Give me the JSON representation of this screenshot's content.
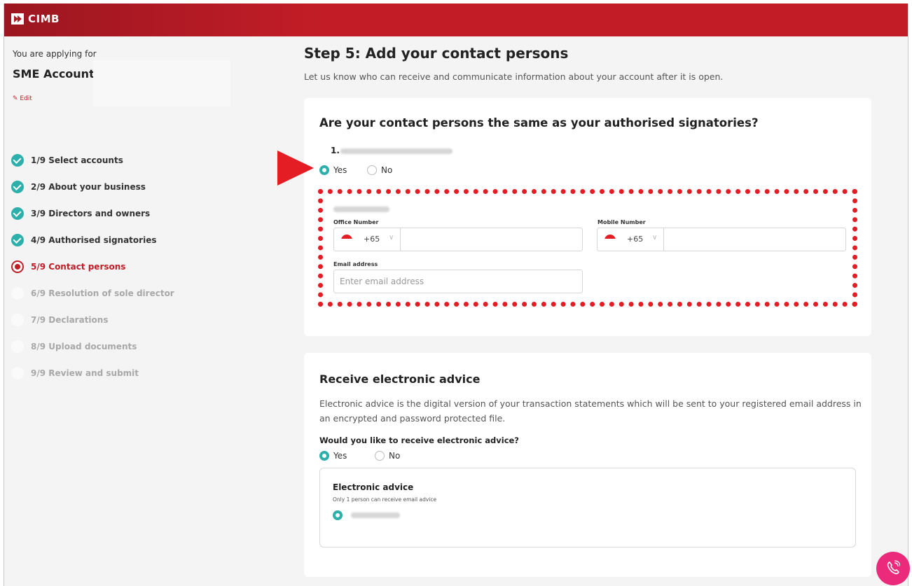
{
  "header": {
    "brand": "CIMB"
  },
  "sidebar": {
    "applying_label": "You are applying for",
    "account_name": "SME Account",
    "edit_label": "Edit",
    "steps": [
      {
        "label": "1/9 Select accounts",
        "status": "done"
      },
      {
        "label": "2/9 About your business",
        "status": "done"
      },
      {
        "label": "3/9 Directors and owners",
        "status": "done"
      },
      {
        "label": "4/9 Authorised signatories",
        "status": "done"
      },
      {
        "label": "5/9 Contact persons",
        "status": "current"
      },
      {
        "label": "6/9 Resolution of sole director",
        "status": "todo"
      },
      {
        "label": "7/9 Declarations",
        "status": "todo"
      },
      {
        "label": "8/9 Upload documents",
        "status": "todo"
      },
      {
        "label": "9/9 Review and submit",
        "status": "todo"
      }
    ]
  },
  "main": {
    "title": "Step 5: Add your contact persons",
    "subtitle": "Let us know who can receive and communicate information about your account after it is open.",
    "contact_card": {
      "question": "Are your contact persons the same as your authorised signatories?",
      "person_number": "1.",
      "yes_label": "Yes",
      "no_label": "No",
      "selected": "yes",
      "office_label": "Office Number",
      "mobile_label": "Mobile Number",
      "office_code": "+65",
      "mobile_code": "+65",
      "email_label": "Email address",
      "email_placeholder": "Enter email address"
    },
    "advice_card": {
      "title": "Receive electronic advice",
      "description": "Electronic advice is the digital version of your transaction statements which will be sent to your registered email address in an encrypted and password protected file.",
      "question": "Would you like to receive electronic advice?",
      "yes_label": "Yes",
      "no_label": "No",
      "selected": "yes",
      "box_title": "Electronic advice",
      "box_subtitle": "Only 1 person can receive email advice"
    }
  },
  "colors": {
    "brand_red": "#c21d27",
    "teal": "#2dafab",
    "highlight_red": "#e41c24",
    "fab_pink": "#ec2a7c"
  },
  "icons": [
    "cimb-logo-icon",
    "pencil-icon",
    "check-icon",
    "singapore-flag-icon",
    "chevron-down-icon",
    "phone-call-icon",
    "pointer-arrow-icon"
  ]
}
